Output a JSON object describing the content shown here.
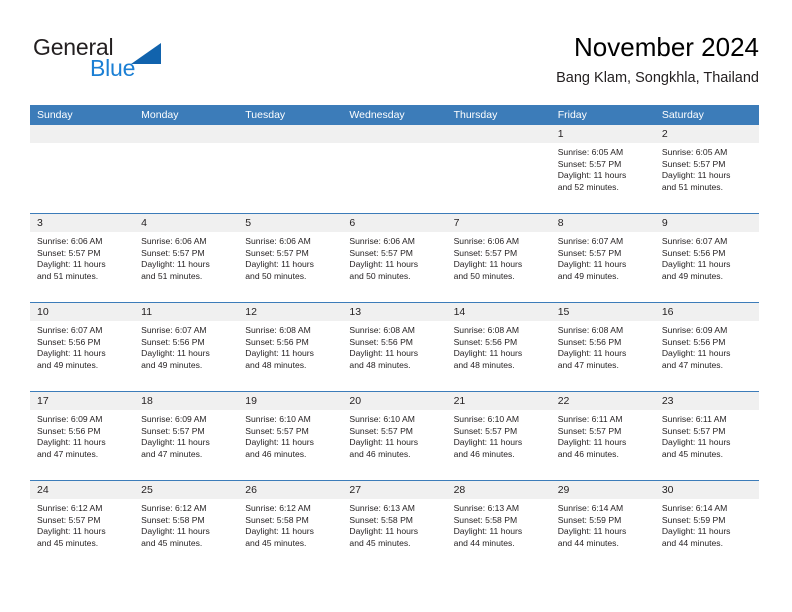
{
  "brand": {
    "name_part1": "General",
    "name_part2": "Blue",
    "mark": "triangle-logo-mark",
    "colors": {
      "dark": "#231f20",
      "blue": "#1b7fd4",
      "mark": "#1163ad"
    }
  },
  "header": {
    "title": "November 2024",
    "subtitle": "Bang Klam, Songkhla, Thailand"
  },
  "theme": {
    "header_blue": "#3c7cb9",
    "daynum_bg": "#f0f0f0",
    "text": "#231f20"
  },
  "weekdays": [
    "Sunday",
    "Monday",
    "Tuesday",
    "Wednesday",
    "Thursday",
    "Friday",
    "Saturday"
  ],
  "weeks": [
    [
      {
        "day": "",
        "sunrise": "",
        "sunset": "",
        "daylight_line1": "",
        "daylight_line2": ""
      },
      {
        "day": "",
        "sunrise": "",
        "sunset": "",
        "daylight_line1": "",
        "daylight_line2": ""
      },
      {
        "day": "",
        "sunrise": "",
        "sunset": "",
        "daylight_line1": "",
        "daylight_line2": ""
      },
      {
        "day": "",
        "sunrise": "",
        "sunset": "",
        "daylight_line1": "",
        "daylight_line2": ""
      },
      {
        "day": "",
        "sunrise": "",
        "sunset": "",
        "daylight_line1": "",
        "daylight_line2": ""
      },
      {
        "day": "1",
        "sunrise": "Sunrise: 6:05 AM",
        "sunset": "Sunset: 5:57 PM",
        "daylight_line1": "Daylight: 11 hours",
        "daylight_line2": "and 52 minutes."
      },
      {
        "day": "2",
        "sunrise": "Sunrise: 6:05 AM",
        "sunset": "Sunset: 5:57 PM",
        "daylight_line1": "Daylight: 11 hours",
        "daylight_line2": "and 51 minutes."
      }
    ],
    [
      {
        "day": "3",
        "sunrise": "Sunrise: 6:06 AM",
        "sunset": "Sunset: 5:57 PM",
        "daylight_line1": "Daylight: 11 hours",
        "daylight_line2": "and 51 minutes."
      },
      {
        "day": "4",
        "sunrise": "Sunrise: 6:06 AM",
        "sunset": "Sunset: 5:57 PM",
        "daylight_line1": "Daylight: 11 hours",
        "daylight_line2": "and 51 minutes."
      },
      {
        "day": "5",
        "sunrise": "Sunrise: 6:06 AM",
        "sunset": "Sunset: 5:57 PM",
        "daylight_line1": "Daylight: 11 hours",
        "daylight_line2": "and 50 minutes."
      },
      {
        "day": "6",
        "sunrise": "Sunrise: 6:06 AM",
        "sunset": "Sunset: 5:57 PM",
        "daylight_line1": "Daylight: 11 hours",
        "daylight_line2": "and 50 minutes."
      },
      {
        "day": "7",
        "sunrise": "Sunrise: 6:06 AM",
        "sunset": "Sunset: 5:57 PM",
        "daylight_line1": "Daylight: 11 hours",
        "daylight_line2": "and 50 minutes."
      },
      {
        "day": "8",
        "sunrise": "Sunrise: 6:07 AM",
        "sunset": "Sunset: 5:57 PM",
        "daylight_line1": "Daylight: 11 hours",
        "daylight_line2": "and 49 minutes."
      },
      {
        "day": "9",
        "sunrise": "Sunrise: 6:07 AM",
        "sunset": "Sunset: 5:56 PM",
        "daylight_line1": "Daylight: 11 hours",
        "daylight_line2": "and 49 minutes."
      }
    ],
    [
      {
        "day": "10",
        "sunrise": "Sunrise: 6:07 AM",
        "sunset": "Sunset: 5:56 PM",
        "daylight_line1": "Daylight: 11 hours",
        "daylight_line2": "and 49 minutes."
      },
      {
        "day": "11",
        "sunrise": "Sunrise: 6:07 AM",
        "sunset": "Sunset: 5:56 PM",
        "daylight_line1": "Daylight: 11 hours",
        "daylight_line2": "and 49 minutes."
      },
      {
        "day": "12",
        "sunrise": "Sunrise: 6:08 AM",
        "sunset": "Sunset: 5:56 PM",
        "daylight_line1": "Daylight: 11 hours",
        "daylight_line2": "and 48 minutes."
      },
      {
        "day": "13",
        "sunrise": "Sunrise: 6:08 AM",
        "sunset": "Sunset: 5:56 PM",
        "daylight_line1": "Daylight: 11 hours",
        "daylight_line2": "and 48 minutes."
      },
      {
        "day": "14",
        "sunrise": "Sunrise: 6:08 AM",
        "sunset": "Sunset: 5:56 PM",
        "daylight_line1": "Daylight: 11 hours",
        "daylight_line2": "and 48 minutes."
      },
      {
        "day": "15",
        "sunrise": "Sunrise: 6:08 AM",
        "sunset": "Sunset: 5:56 PM",
        "daylight_line1": "Daylight: 11 hours",
        "daylight_line2": "and 47 minutes."
      },
      {
        "day": "16",
        "sunrise": "Sunrise: 6:09 AM",
        "sunset": "Sunset: 5:56 PM",
        "daylight_line1": "Daylight: 11 hours",
        "daylight_line2": "and 47 minutes."
      }
    ],
    [
      {
        "day": "17",
        "sunrise": "Sunrise: 6:09 AM",
        "sunset": "Sunset: 5:56 PM",
        "daylight_line1": "Daylight: 11 hours",
        "daylight_line2": "and 47 minutes."
      },
      {
        "day": "18",
        "sunrise": "Sunrise: 6:09 AM",
        "sunset": "Sunset: 5:57 PM",
        "daylight_line1": "Daylight: 11 hours",
        "daylight_line2": "and 47 minutes."
      },
      {
        "day": "19",
        "sunrise": "Sunrise: 6:10 AM",
        "sunset": "Sunset: 5:57 PM",
        "daylight_line1": "Daylight: 11 hours",
        "daylight_line2": "and 46 minutes."
      },
      {
        "day": "20",
        "sunrise": "Sunrise: 6:10 AM",
        "sunset": "Sunset: 5:57 PM",
        "daylight_line1": "Daylight: 11 hours",
        "daylight_line2": "and 46 minutes."
      },
      {
        "day": "21",
        "sunrise": "Sunrise: 6:10 AM",
        "sunset": "Sunset: 5:57 PM",
        "daylight_line1": "Daylight: 11 hours",
        "daylight_line2": "and 46 minutes."
      },
      {
        "day": "22",
        "sunrise": "Sunrise: 6:11 AM",
        "sunset": "Sunset: 5:57 PM",
        "daylight_line1": "Daylight: 11 hours",
        "daylight_line2": "and 46 minutes."
      },
      {
        "day": "23",
        "sunrise": "Sunrise: 6:11 AM",
        "sunset": "Sunset: 5:57 PM",
        "daylight_line1": "Daylight: 11 hours",
        "daylight_line2": "and 45 minutes."
      }
    ],
    [
      {
        "day": "24",
        "sunrise": "Sunrise: 6:12 AM",
        "sunset": "Sunset: 5:57 PM",
        "daylight_line1": "Daylight: 11 hours",
        "daylight_line2": "and 45 minutes."
      },
      {
        "day": "25",
        "sunrise": "Sunrise: 6:12 AM",
        "sunset": "Sunset: 5:58 PM",
        "daylight_line1": "Daylight: 11 hours",
        "daylight_line2": "and 45 minutes."
      },
      {
        "day": "26",
        "sunrise": "Sunrise: 6:12 AM",
        "sunset": "Sunset: 5:58 PM",
        "daylight_line1": "Daylight: 11 hours",
        "daylight_line2": "and 45 minutes."
      },
      {
        "day": "27",
        "sunrise": "Sunrise: 6:13 AM",
        "sunset": "Sunset: 5:58 PM",
        "daylight_line1": "Daylight: 11 hours",
        "daylight_line2": "and 45 minutes."
      },
      {
        "day": "28",
        "sunrise": "Sunrise: 6:13 AM",
        "sunset": "Sunset: 5:58 PM",
        "daylight_line1": "Daylight: 11 hours",
        "daylight_line2": "and 44 minutes."
      },
      {
        "day": "29",
        "sunrise": "Sunrise: 6:14 AM",
        "sunset": "Sunset: 5:59 PM",
        "daylight_line1": "Daylight: 11 hours",
        "daylight_line2": "and 44 minutes."
      },
      {
        "day": "30",
        "sunrise": "Sunrise: 6:14 AM",
        "sunset": "Sunset: 5:59 PM",
        "daylight_line1": "Daylight: 11 hours",
        "daylight_line2": "and 44 minutes."
      }
    ]
  ]
}
